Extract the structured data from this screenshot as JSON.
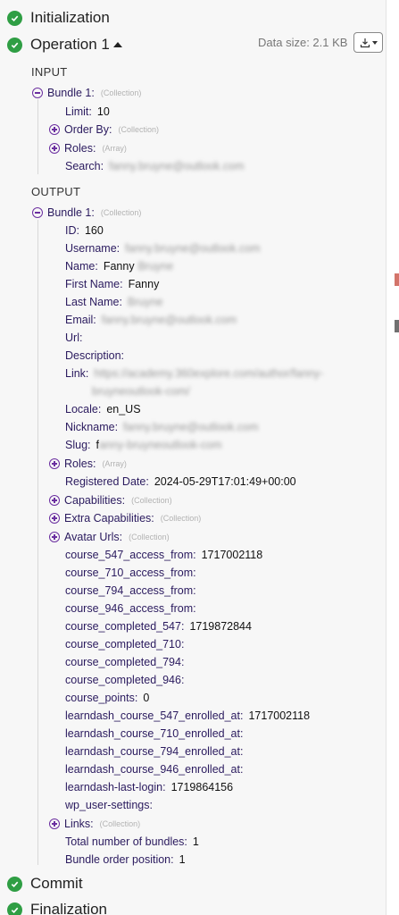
{
  "steps": {
    "initialization": "Initialization",
    "operation": "Operation 1",
    "commit": "Commit",
    "finalization": "Finalization"
  },
  "toolbar": {
    "data_size": "Data size: 2.1 KB"
  },
  "input": {
    "heading": "INPUT",
    "bundle_label": "Bundle 1:",
    "bundle_type": "(Collection)",
    "limit_key": "Limit:",
    "limit_value": "10",
    "orderby_key": "Order By:",
    "orderby_type": "(Collection)",
    "roles_key": "Roles:",
    "roles_type": "(Array)",
    "search_key": "Search:",
    "search_value": "fanny.bruyne@outlook.com"
  },
  "output": {
    "heading": "OUTPUT",
    "bundle_label": "Bundle 1:",
    "bundle_type": "(Collection)",
    "fields": {
      "id": "160",
      "username": "fanny.bruyne@outlook.com",
      "name_first": "Fanny",
      "name_last": "Bruyne",
      "first_name": "Fanny",
      "last_name": "Bruyne",
      "email": "fanny.bruyne@outlook.com",
      "link_1": "https://academy.360explore.com/author/fanny-",
      "link_2": "bruyneoutlook-com/",
      "locale": "en_US",
      "nickname": "fanny.bruyne@outlook.com",
      "slug_first": "f",
      "slug_rest": "anny-bruyneoutlook-com",
      "registered_date": "2024-05-29T17:01:49+00:00",
      "course_547_access_from": "1717002118",
      "course_completed_547": "1719872844",
      "course_points": "0",
      "learndash_course_547_enrolled_at": "1717002118",
      "learndash_last_login": "1719864156",
      "total_bundles": "1",
      "bundle_order_position": "1"
    },
    "keys": {
      "id": "ID:",
      "username": "Username:",
      "name": "Name:",
      "first_name": "First Name:",
      "last_name": "Last Name:",
      "email": "Email:",
      "url": "Url:",
      "description": "Description:",
      "link": "Link:",
      "locale": "Locale:",
      "nickname": "Nickname:",
      "slug": "Slug:",
      "roles": "Roles:",
      "registered_date": "Registered Date:",
      "capabilities": "Capabilities:",
      "extra_capabilities": "Extra Capabilities:",
      "avatar_urls": "Avatar Urls:",
      "c547": "course_547_access_from:",
      "c710": "course_710_access_from:",
      "c794": "course_794_access_from:",
      "c946": "course_946_access_from:",
      "cc547": "course_completed_547:",
      "cc710": "course_completed_710:",
      "cc794": "course_completed_794:",
      "cc946": "course_completed_946:",
      "points": "course_points:",
      "le547": "learndash_course_547_enrolled_at:",
      "le710": "learndash_course_710_enrolled_at:",
      "le794": "learndash_course_794_enrolled_at:",
      "le946": "learndash_course_946_enrolled_at:",
      "lastlogin": "learndash-last-login:",
      "wpsettings": "wp_user-settings:",
      "links": "Links:",
      "total": "Total number of bundles:",
      "order": "Bundle order position:"
    },
    "types": {
      "roles": "(Array)",
      "capabilities": "(Collection)",
      "extra_capabilities": "(Collection)",
      "avatar_urls": "(Collection)",
      "links": "(Collection)"
    }
  },
  "colors": {
    "success": "#2f9e44",
    "toggle": "#6b2fa0",
    "key": "#2a1a5e"
  },
  "icons": {
    "check": "check-circle-icon",
    "download": "download-icon",
    "toggle": "expand-collapse-icon"
  }
}
